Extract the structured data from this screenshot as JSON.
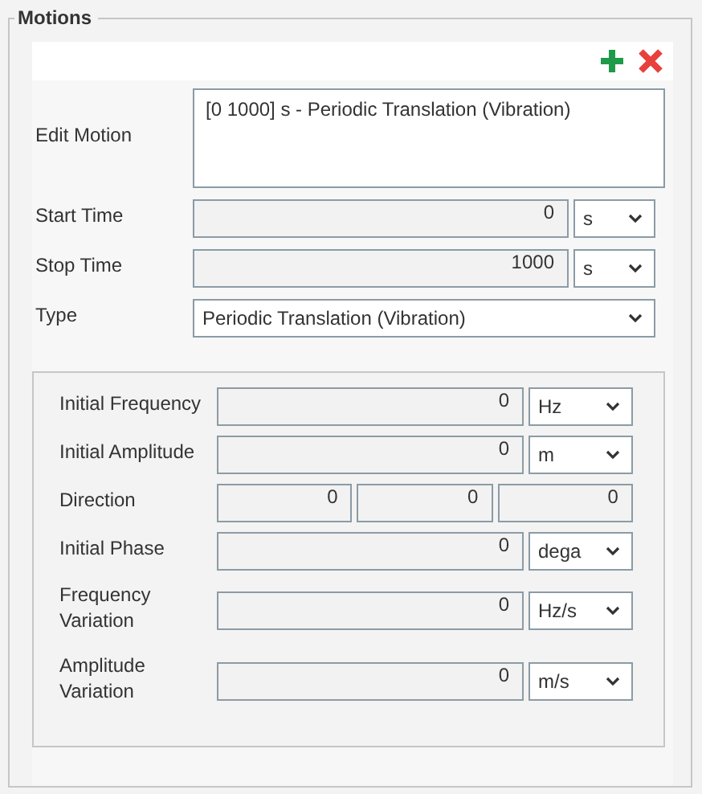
{
  "group": {
    "title": "Motions"
  },
  "edit_motion": {
    "label": "Edit Motion",
    "items": [
      "[0 1000] s - Periodic Translation (Vibration)"
    ]
  },
  "times": [
    {
      "label": "Start Time",
      "value": "0",
      "unit": "s"
    },
    {
      "label": "Stop Time",
      "value": "1000",
      "unit": "s"
    }
  ],
  "type": {
    "label": "Type",
    "value": "Periodic Translation (Vibration)"
  },
  "parameters": [
    {
      "kind": "scalar",
      "label": "Initial Frequency",
      "value": "0",
      "unit": "Hz"
    },
    {
      "kind": "scalar",
      "label": "Initial Amplitude",
      "value": "0",
      "unit": "m"
    },
    {
      "kind": "vector",
      "label": "Direction",
      "values": [
        "0",
        "0",
        "0"
      ]
    },
    {
      "kind": "scalar",
      "label": "Initial Phase",
      "value": "0",
      "unit": "dega"
    },
    {
      "kind": "scalar",
      "label": "Frequency Variation",
      "value": "0",
      "unit": "Hz/s"
    },
    {
      "kind": "scalar",
      "label": "Amplitude Variation",
      "value": "0",
      "unit": "m/s"
    }
  ]
}
